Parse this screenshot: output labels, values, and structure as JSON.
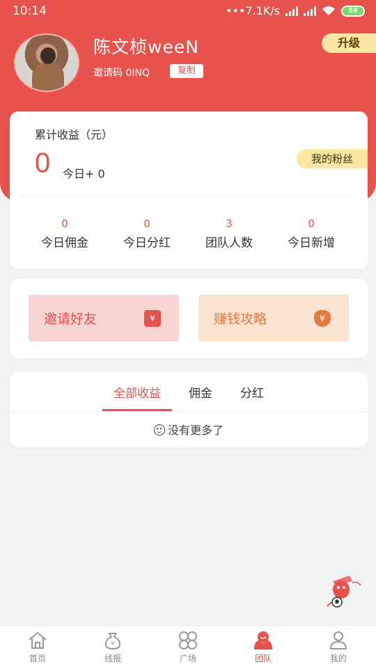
{
  "status_bar": {
    "time": "10:14",
    "speed": "7.1K/s",
    "battery": "59"
  },
  "profile": {
    "name": "陈文桢weeN",
    "invite_code": "邀请码 0INQ",
    "copy_label": "复制",
    "upgrade_label": "升级"
  },
  "earnings": {
    "title": "累计收益（元）",
    "total": "0",
    "today": "今日+ 0",
    "fans_label": "我的粉丝",
    "stats": [
      {
        "value": "0",
        "label": "今日佣金"
      },
      {
        "value": "0",
        "label": "今日分红"
      },
      {
        "value": "3",
        "label": "团队人数"
      },
      {
        "value": "0",
        "label": "今日新增"
      }
    ]
  },
  "actions": {
    "invite_label": "邀请好友",
    "invite_icon": "red-packet-icon",
    "guide_label": "赚钱攻略",
    "guide_icon": "money-bag-icon"
  },
  "income_tabs": {
    "tabs": [
      "全部收益",
      "佣金",
      "分红"
    ],
    "active": 0,
    "empty_text": "没有更多了"
  },
  "bottom_nav": {
    "items": [
      {
        "label": "首页",
        "icon": "home-icon"
      },
      {
        "label": "线报",
        "icon": "money-bag-icon"
      },
      {
        "label": "广场",
        "icon": "grid-icon"
      },
      {
        "label": "团队",
        "icon": "team-icon"
      },
      {
        "label": "我的",
        "icon": "user-icon"
      }
    ],
    "active": 3
  },
  "colors": {
    "brand": "#e8524d",
    "gold": "#fbe6a4",
    "invite_bg": "#f8d4d2",
    "guide_bg": "#fbe4cf"
  }
}
